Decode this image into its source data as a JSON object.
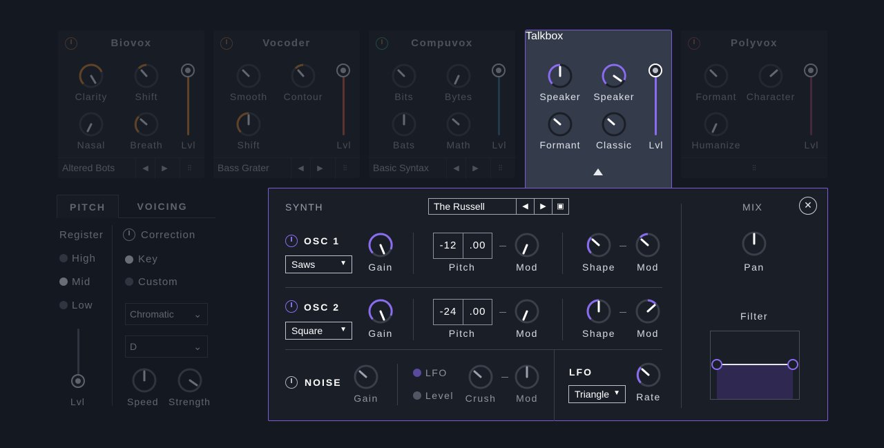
{
  "modules": [
    {
      "title": "Biovox",
      "preset": "Altered Bots",
      "knobs": [
        "Clarity",
        "Shift",
        "Nasal",
        "Breath"
      ],
      "slider": "Lvl"
    },
    {
      "title": "Vocoder",
      "preset": "Bass Grater",
      "knobs": [
        "Smooth",
        "Contour",
        "Shift"
      ],
      "slider": "Lvl"
    },
    {
      "title": "Compuvox",
      "preset": "Basic Syntax",
      "knobs": [
        "Bits",
        "Bytes",
        "Bats",
        "Math"
      ],
      "slider": "Lvl"
    },
    {
      "title": "Talkbox",
      "knobs": [
        "Speaker",
        "Speaker",
        "Formant",
        "Classic"
      ],
      "slider": "Lvl"
    },
    {
      "title": "Polyvox",
      "knobs": [
        "Formant",
        "Character",
        "Humanize"
      ],
      "slider": "Lvl"
    }
  ],
  "left_panel": {
    "tabs": [
      "PITCH",
      "VOICING"
    ],
    "register_label": "Register",
    "register_options": [
      "High",
      "Mid",
      "Low"
    ],
    "register_selected": "Mid",
    "correction_label": "Correction",
    "correction_options": [
      "Key",
      "Custom"
    ],
    "correction_selected": "Key",
    "scale_select": "Chromatic",
    "key_select": "D",
    "slider_label": "Lvl",
    "knobs": [
      "Speed",
      "Strength"
    ]
  },
  "synth": {
    "header": "SYNTH",
    "preset": "The Russell",
    "mix_header": "MIX",
    "osc1": {
      "label": "OSC 1",
      "wave": "Saws",
      "gain": "Gain",
      "pitch_semi": "-12",
      "pitch_fine": ".00",
      "pitch": "Pitch",
      "mod": "Mod",
      "shape": "Shape",
      "shape_mod": "Mod"
    },
    "osc2": {
      "label": "OSC 2",
      "wave": "Square",
      "gain": "Gain",
      "pitch_semi": "-24",
      "pitch_fine": ".00",
      "pitch": "Pitch",
      "mod": "Mod",
      "shape": "Shape",
      "shape_mod": "Mod"
    },
    "noise": {
      "label": "NOISE",
      "gain": "Gain",
      "lfo_opt": "LFO",
      "level_opt": "Level",
      "crush": "Crush",
      "mod": "Mod"
    },
    "lfo": {
      "label": "LFO",
      "shape": "Triangle",
      "rate": "Rate"
    },
    "pan": "Pan",
    "filter": "Filter"
  },
  "colors": {
    "accent": "#7b5cd6",
    "knob_orange": "#c7802f",
    "background": "#141820"
  },
  "icons": [
    "power-icon",
    "prev-arrow-icon",
    "next-arrow-icon",
    "mixer-icon",
    "save-icon",
    "close-icon",
    "chevron-down-icon"
  ]
}
